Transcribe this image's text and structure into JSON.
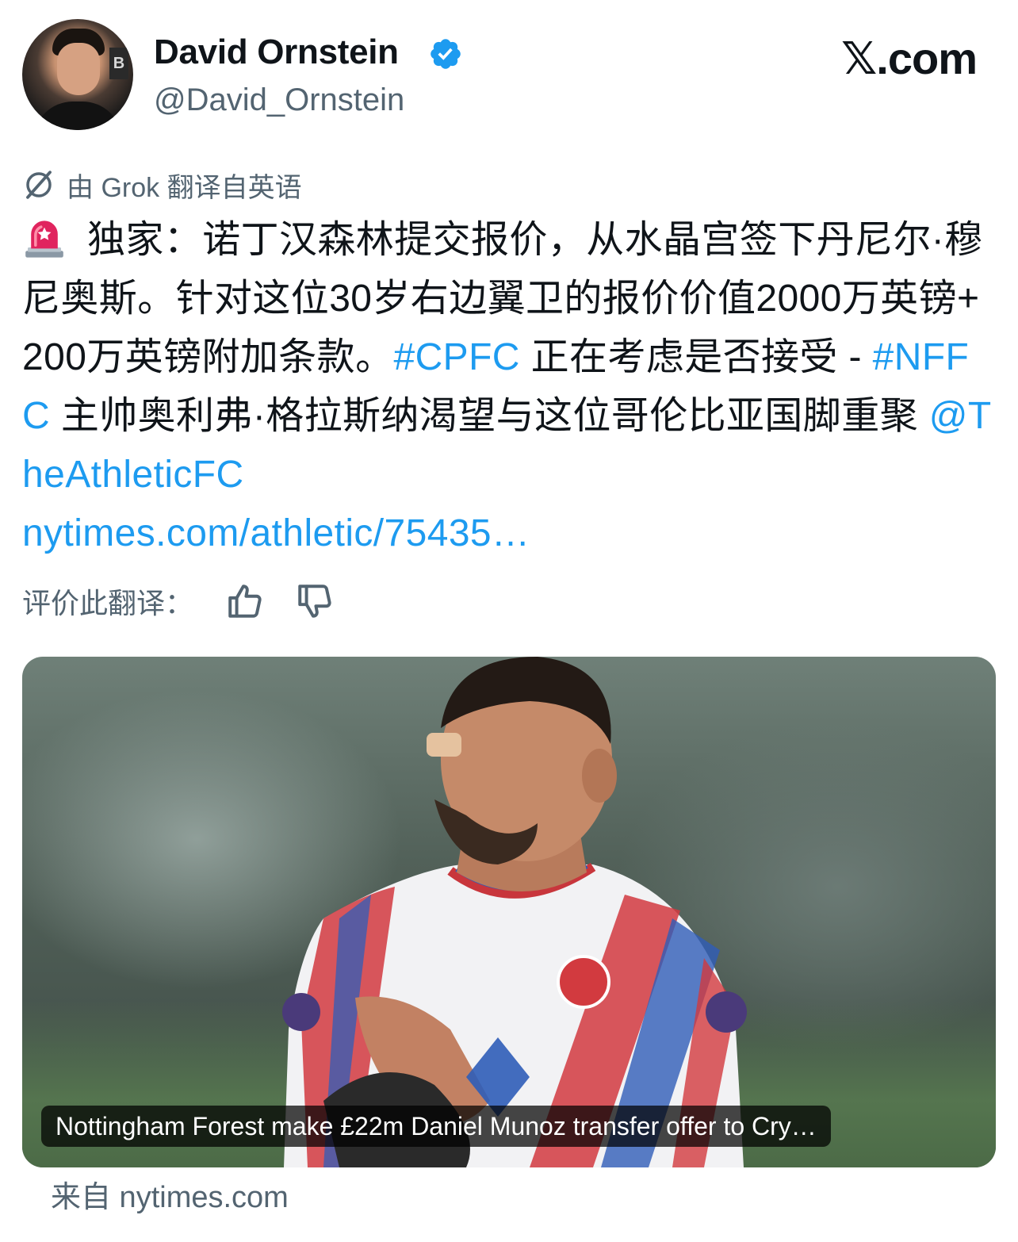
{
  "author": {
    "display_name": "David Ornstein",
    "handle": "@David_Ornstein",
    "verified": true
  },
  "site_mark": "𝕏.com",
  "translation": {
    "notice": "由 Grok 翻译自英语",
    "rate_label": "评价此翻译："
  },
  "tweet": {
    "segments": [
      {
        "type": "text",
        "text": "独家：诺丁汉森林提交报价，从水晶宫签下丹尼尔·穆尼奥斯。针对这位30岁右边翼卫的报价价值2000万英镑+200万英镑附加条款。"
      },
      {
        "type": "link",
        "text": "#CPFC"
      },
      {
        "type": "text",
        "text": " 正在考虑是否接受 - "
      },
      {
        "type": "link",
        "text": "#NFFC"
      },
      {
        "type": "text",
        "text": " 主帅奥利弗·格拉斯纳渴望与这位哥伦比亚国脚重聚 "
      },
      {
        "type": "link",
        "text": "@TheAthleticFC"
      },
      {
        "type": "link",
        "text": "nytimes.com/athletic/75435…"
      }
    ]
  },
  "card": {
    "caption": "Nottingham Forest make £22m Daniel Munoz transfer offer to Cry…",
    "source": "来自 nytimes.com"
  },
  "colors": {
    "link": "#1d9bf0",
    "secondary_text": "#536471",
    "verified_badge": "#1d9bf0",
    "siren": "#e0245e"
  },
  "icons": [
    "verified-icon",
    "siren-icon",
    "grok-translate-icon",
    "thumbs-up-icon",
    "thumbs-down-icon"
  ]
}
